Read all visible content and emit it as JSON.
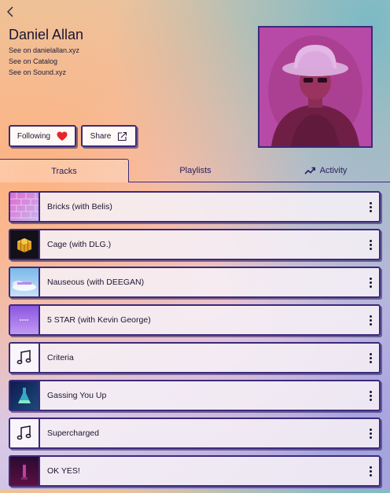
{
  "artist": {
    "name": "Daniel Allan",
    "links": [
      "See on danielallan.xyz",
      "See on Catalog",
      "See on Sound.xyz"
    ]
  },
  "actions": {
    "following_label": "Following",
    "share_label": "Share"
  },
  "tabs": [
    {
      "label": "Tracks",
      "active": true
    },
    {
      "label": "Playlists",
      "active": false
    },
    {
      "label": "Activity",
      "active": false,
      "icon": "trending-up-icon"
    }
  ],
  "tracks": [
    {
      "title": "Bricks (with Belis)",
      "thumb": "bricks-artwork"
    },
    {
      "title": "Cage (with DLG.)",
      "thumb": "cage-artwork"
    },
    {
      "title": "Nauseous (with DEEGAN)",
      "thumb": "nauseous-artwork"
    },
    {
      "title": "5 STAR (with Kevin George)",
      "thumb": "five-star-artwork"
    },
    {
      "title": "Criteria",
      "thumb": "music-note-icon"
    },
    {
      "title": "Gassing You Up",
      "thumb": "gassing-artwork"
    },
    {
      "title": "Supercharged",
      "thumb": "music-note-icon"
    },
    {
      "title": "OK YES!",
      "thumb": "ok-yes-artwork"
    }
  ],
  "colors": {
    "accent_border": "#3b2a7c",
    "heart": "#e8232c"
  }
}
